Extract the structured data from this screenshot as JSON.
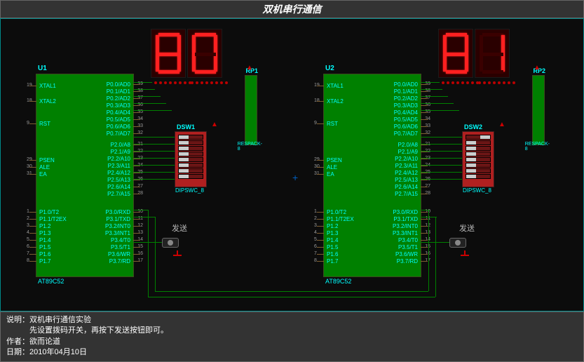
{
  "title": "双机串行通信",
  "footer": {
    "line1": "说明：双机串行通信实验",
    "line2": "　　　先设置拨码开关，再按下发送按钮即可。",
    "line3": "作者：欲而论道",
    "line4": "日期：2010年04月10日"
  },
  "mcu1": {
    "ref": "U1",
    "part": "AT89C52",
    "left_pins": [
      {
        "num": "19",
        "name": "XTAL1"
      },
      {
        "num": "18",
        "name": "XTAL2"
      },
      {
        "num": "9",
        "name": "RST"
      },
      {
        "num": "29",
        "name": "PSEN"
      },
      {
        "num": "30",
        "name": "ALE"
      },
      {
        "num": "31",
        "name": "EA"
      },
      {
        "num": "1",
        "name": "P1.0/T2"
      },
      {
        "num": "2",
        "name": "P1.1/T2EX"
      },
      {
        "num": "3",
        "name": "P1.2"
      },
      {
        "num": "4",
        "name": "P1.3"
      },
      {
        "num": "5",
        "name": "P1.4"
      },
      {
        "num": "6",
        "name": "P1.5"
      },
      {
        "num": "7",
        "name": "P1.6"
      },
      {
        "num": "8",
        "name": "P1.7"
      }
    ],
    "right_pins": [
      {
        "num": "39",
        "name": "P0.0/AD0"
      },
      {
        "num": "38",
        "name": "P0.1/AD1"
      },
      {
        "num": "37",
        "name": "P0.2/AD2"
      },
      {
        "num": "36",
        "name": "P0.3/AD3"
      },
      {
        "num": "35",
        "name": "P0.4/AD4"
      },
      {
        "num": "34",
        "name": "P0.5/AD5"
      },
      {
        "num": "33",
        "name": "P0.6/AD6"
      },
      {
        "num": "32",
        "name": "P0.7/AD7"
      },
      {
        "num": "21",
        "name": "P2.0/A8"
      },
      {
        "num": "22",
        "name": "P2.1/A9"
      },
      {
        "num": "23",
        "name": "P2.2/A10"
      },
      {
        "num": "24",
        "name": "P2.3/A11"
      },
      {
        "num": "25",
        "name": "P2.4/A12"
      },
      {
        "num": "26",
        "name": "P2.5/A13"
      },
      {
        "num": "27",
        "name": "P2.6/A14"
      },
      {
        "num": "28",
        "name": "P2.7/A15"
      },
      {
        "num": "10",
        "name": "P3.0/RXD"
      },
      {
        "num": "11",
        "name": "P3.1/TXD"
      },
      {
        "num": "12",
        "name": "P3.2/INT0"
      },
      {
        "num": "13",
        "name": "P3.3/INT1"
      },
      {
        "num": "14",
        "name": "P3.4/T0"
      },
      {
        "num": "15",
        "name": "P3.5/T1"
      },
      {
        "num": "16",
        "name": "P3.6/WR"
      },
      {
        "num": "17",
        "name": "P3.7/RD"
      }
    ]
  },
  "mcu2": {
    "ref": "U2",
    "part": "AT89C52"
  },
  "display1": {
    "digit_left": "8",
    "digit_right": "0"
  },
  "display2": {
    "digit_left": "8",
    "digit_right": "1"
  },
  "dsw1": {
    "ref": "DSW1",
    "part": "DIPSWC_8",
    "switches": [
      "left",
      "left",
      "left",
      "left",
      "left",
      "left",
      "left",
      "left"
    ]
  },
  "dsw2": {
    "ref": "DSW2",
    "part": "DIPSWC_8",
    "switches": [
      "right",
      "left",
      "left",
      "left",
      "left",
      "left",
      "left",
      "left"
    ]
  },
  "rp1": {
    "ref": "RP1",
    "part": "RESPACK-8"
  },
  "rp2": {
    "ref": "RP2",
    "part": "RESPACK-8"
  },
  "btn1_label": "发送",
  "btn2_label": "发送"
}
